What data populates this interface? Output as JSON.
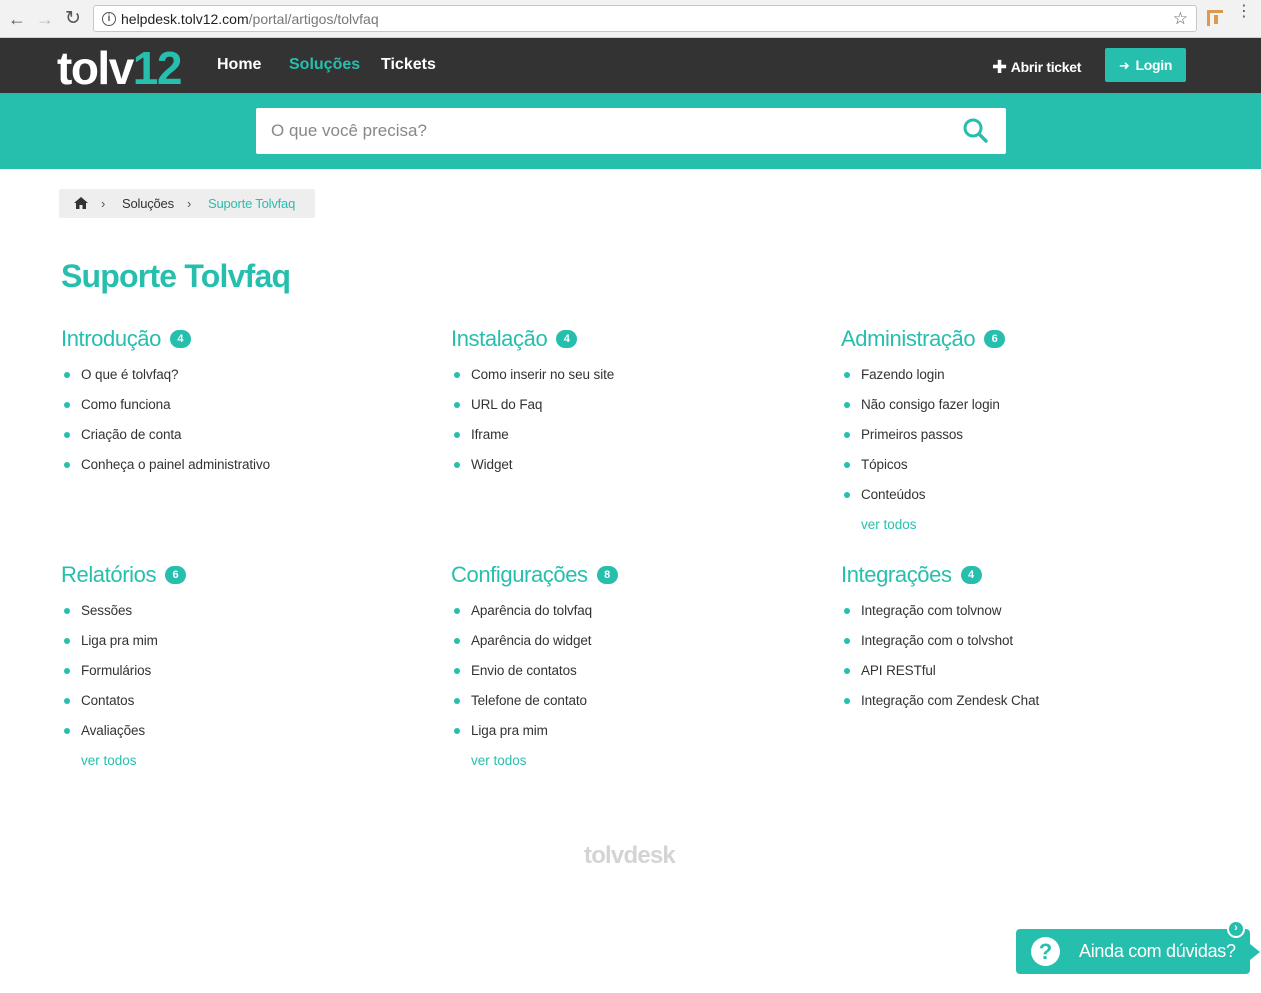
{
  "browser": {
    "url_host": "helpdesk.tolv12.com",
    "url_path": "/portal/artigos/tolvfaq"
  },
  "header": {
    "logo_part1": "tolv",
    "logo_part2": "12",
    "nav": [
      {
        "label": "Home",
        "active": false
      },
      {
        "label": "Soluções",
        "active": true
      },
      {
        "label": "Tickets",
        "active": false
      }
    ],
    "open_ticket": "Abrir ticket",
    "login": "Login"
  },
  "search": {
    "placeholder": "O que você precisa?"
  },
  "breadcrumb": {
    "items": [
      "Soluções",
      "Suporte Tolvfaq"
    ]
  },
  "page_title": "Suporte Tolvfaq",
  "categories": [
    {
      "title": "Introdução",
      "count": "4",
      "items": [
        "O que é tolvfaq?",
        "Como funciona",
        "Criação de conta",
        "Conheça o painel administrativo"
      ],
      "see_all": ""
    },
    {
      "title": "Instalação",
      "count": "4",
      "items": [
        "Como inserir no seu site",
        "URL do Faq",
        "Iframe",
        "Widget"
      ],
      "see_all": ""
    },
    {
      "title": "Administração",
      "count": "6",
      "items": [
        "Fazendo login",
        "Não consigo fazer login",
        "Primeiros passos",
        "Tópicos",
        "Conteúdos"
      ],
      "see_all": "ver todos"
    },
    {
      "title": "Relatórios",
      "count": "6",
      "items": [
        "Sessões",
        "Liga pra mim",
        "Formulários",
        "Contatos",
        "Avaliações"
      ],
      "see_all": "ver todos"
    },
    {
      "title": "Configurações",
      "count": "8",
      "items": [
        "Aparência do tolvfaq",
        "Aparência do widget",
        "Envio de contatos",
        "Telefone de contato",
        "Liga pra mim"
      ],
      "see_all": "ver todos"
    },
    {
      "title": "Integrações",
      "count": "4",
      "items": [
        "Integração com tolvnow",
        "Integração com o tolvshot",
        "API RESTful",
        "Integração com Zendesk Chat"
      ],
      "see_all": ""
    }
  ],
  "footer": {
    "brand": "tolvdesk"
  },
  "help_widget": {
    "label": "Ainda com dúvidas?"
  },
  "colors": {
    "accent": "#26bfad",
    "topbar": "#333333"
  }
}
